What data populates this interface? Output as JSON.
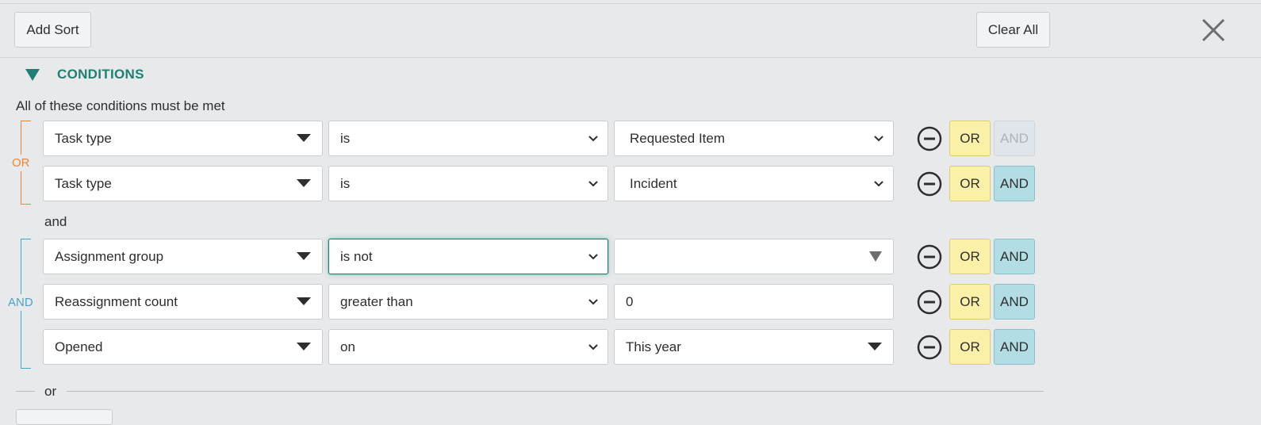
{
  "toolbar": {
    "add_sort": "Add Sort",
    "clear_all": "Clear All"
  },
  "conditions": {
    "title": "CONDITIONS",
    "note": "All of these conditions must be met",
    "groups": [
      {
        "label": "OR",
        "color": "#e8873c",
        "rows": [
          {
            "field": "Task type",
            "operator": "is",
            "value": "Requested Item",
            "or": "OR",
            "and": "AND",
            "and_disabled": true
          },
          {
            "field": "Task type",
            "operator": "is",
            "value": "Incident",
            "or": "OR",
            "and": "AND"
          }
        ]
      },
      {
        "label": "AND",
        "color": "#4aa3c4",
        "rows": [
          {
            "field": "Assignment group",
            "operator": "is not",
            "value": "",
            "or": "OR",
            "and": "AND"
          },
          {
            "field": "Reassignment count",
            "operator": "greater than",
            "value": "0",
            "or": "OR",
            "and": "AND"
          },
          {
            "field": "Opened",
            "operator": "on",
            "value": "This year",
            "or": "OR",
            "and": "AND"
          }
        ]
      }
    ],
    "between_label": "and",
    "or_divider": "or"
  },
  "colors": {
    "accent": "#1f7f73",
    "or_button": "#fbf0a8",
    "and_button": "#b3dde4"
  }
}
